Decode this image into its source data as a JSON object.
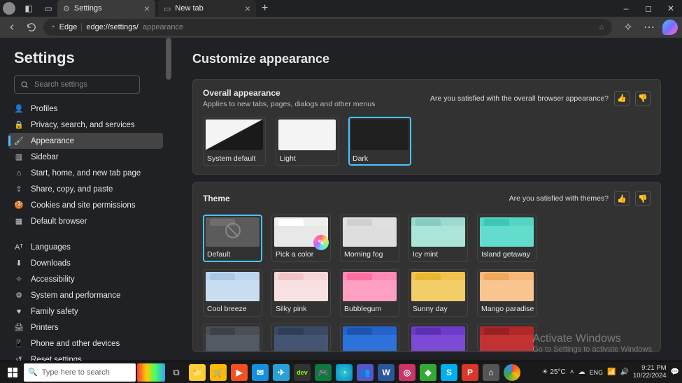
{
  "window": {
    "tabs": [
      {
        "label": "Settings",
        "icon": "gear-icon"
      },
      {
        "label": "New tab",
        "icon": "tab-icon"
      }
    ],
    "minimize": "–",
    "maximize": "◻",
    "close": "✕"
  },
  "toolbar": {
    "edge_label": "Edge",
    "url_main": "edge://settings/",
    "url_sub": "appearance"
  },
  "sidebar": {
    "title": "Settings",
    "search_placeholder": "Search settings",
    "group1": [
      {
        "icon": "👤",
        "label": "Profiles"
      },
      {
        "icon": "🔒",
        "label": "Privacy, search, and services"
      },
      {
        "icon": "🖌",
        "label": "Appearance",
        "active": true
      },
      {
        "icon": "▥",
        "label": "Sidebar"
      },
      {
        "icon": "⌂",
        "label": "Start, home, and new tab page"
      },
      {
        "icon": "⇪",
        "label": "Share, copy, and paste"
      },
      {
        "icon": "🍪",
        "label": "Cookies and site permissions"
      },
      {
        "icon": "▦",
        "label": "Default browser"
      }
    ],
    "group2": [
      {
        "icon": "Aᵀ",
        "label": "Languages"
      },
      {
        "icon": "⬇",
        "label": "Downloads"
      },
      {
        "icon": "✧",
        "label": "Accessibility"
      },
      {
        "icon": "⚙",
        "label": "System and performance"
      },
      {
        "icon": "♥",
        "label": "Family safety"
      },
      {
        "icon": "🖨",
        "label": "Printers"
      },
      {
        "icon": "📱",
        "label": "Phone and other devices"
      },
      {
        "icon": "↺",
        "label": "Reset settings"
      }
    ]
  },
  "content": {
    "heading": "Customize appearance",
    "overall": {
      "title": "Overall appearance",
      "subtitle": "Applies to new tabs, pages, dialogs and other menus",
      "feedback_q": "Are you satisfied with the overall browser appearance?",
      "options": [
        {
          "label": "System default"
        },
        {
          "label": "Light"
        },
        {
          "label": "Dark",
          "selected": true
        }
      ]
    },
    "theme": {
      "title": "Theme",
      "feedback_q": "Are you satisfied with themes?",
      "row1": [
        {
          "label": "Default",
          "bg": "#5b5b5b",
          "tab": "#6e6e6e",
          "body": "#5b5b5b",
          "selected": true,
          "default": true
        },
        {
          "label": "Pick a color",
          "bg": "#eeeeee",
          "tab": "#ffffff",
          "body": "#e8e8e8",
          "picker": true
        },
        {
          "label": "Morning fog",
          "bg": "#e0e0e0",
          "tab": "#d0d0d0",
          "body": "#dedede"
        },
        {
          "label": "Icy mint",
          "bg": "#9dd9cf",
          "tab": "#86ccc0",
          "body": "#abe4d9"
        },
        {
          "label": "Island getaway",
          "bg": "#54d5c4",
          "tab": "#3cc7b4",
          "body": "#62ddcd"
        }
      ],
      "row2": [
        {
          "label": "Cool breeze",
          "bg": "#bdd6ee",
          "tab": "#a8c8e6",
          "body": "#c9def2"
        },
        {
          "label": "Silky pink",
          "bg": "#f6d7d9",
          "tab": "#f1c4c7",
          "body": "#f8e1e2"
        },
        {
          "label": "Bubblegum",
          "bg": "#ff8ab5",
          "tab": "#ff6ea3",
          "body": "#ffa0c3"
        },
        {
          "label": "Sunny day",
          "bg": "#f0c34e",
          "tab": "#eab735",
          "body": "#f3cd68"
        },
        {
          "label": "Mango paradise",
          "bg": "#f7b87a",
          "tab": "#f3a75c",
          "body": "#f9c590"
        }
      ],
      "row3": [
        {
          "bg": "#4a4f57",
          "tab": "#3c4048",
          "body": "#545a63"
        },
        {
          "bg": "#3a4a66",
          "tab": "#2f3d56",
          "body": "#445574"
        },
        {
          "bg": "#2463c9",
          "tab": "#1c54b0",
          "body": "#2d72db"
        },
        {
          "bg": "#6c3bc9",
          "tab": "#5c2fb5",
          "body": "#7b4bd6"
        },
        {
          "bg": "#b02828",
          "tab": "#992020",
          "body": "#c23232"
        }
      ]
    }
  },
  "watermark": {
    "line1": "Activate Windows",
    "line2": "Go to Settings to activate Windows."
  },
  "taskbar": {
    "search_placeholder": "Type here to search",
    "weather": "25°C",
    "time": "9:21 PM",
    "date": "10/22/2024"
  }
}
